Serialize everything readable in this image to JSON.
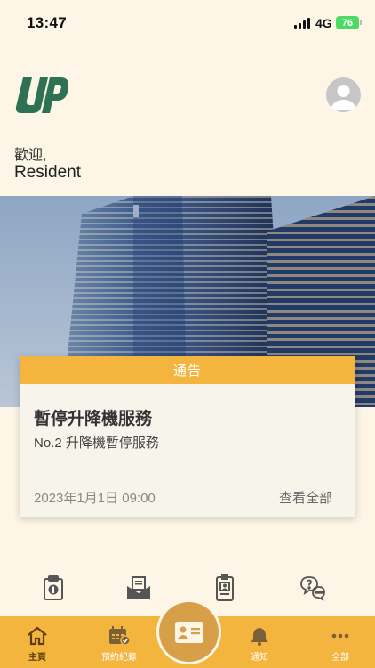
{
  "status": {
    "time": "13:47",
    "network": "4G",
    "battery": "76"
  },
  "header": {
    "greeting": "歡迎,",
    "username": "Resident"
  },
  "notice": {
    "header": "通告",
    "title": "暫停升降機服務",
    "body": "No.2 升降機暫停服務",
    "date": "2023年1月1日 09:00",
    "more": "查看全部"
  },
  "quick_actions": [
    {
      "icon": "clipboard-alert-icon"
    },
    {
      "icon": "mail-open-icon"
    },
    {
      "icon": "id-badge-icon"
    },
    {
      "icon": "chat-question-icon"
    }
  ],
  "tabs": [
    {
      "label": "主頁",
      "icon": "home-icon",
      "active": true
    },
    {
      "label": "預約紀錄",
      "icon": "calendar-check-icon"
    },
    {
      "label": "通知",
      "icon": "bell-icon"
    },
    {
      "label": "全部",
      "icon": "more-dots-icon"
    }
  ],
  "center_button": {
    "icon": "id-card-icon"
  },
  "colors": {
    "background": "#fdf6e6",
    "accent": "#f4b53f",
    "brand": "#2f7155"
  }
}
